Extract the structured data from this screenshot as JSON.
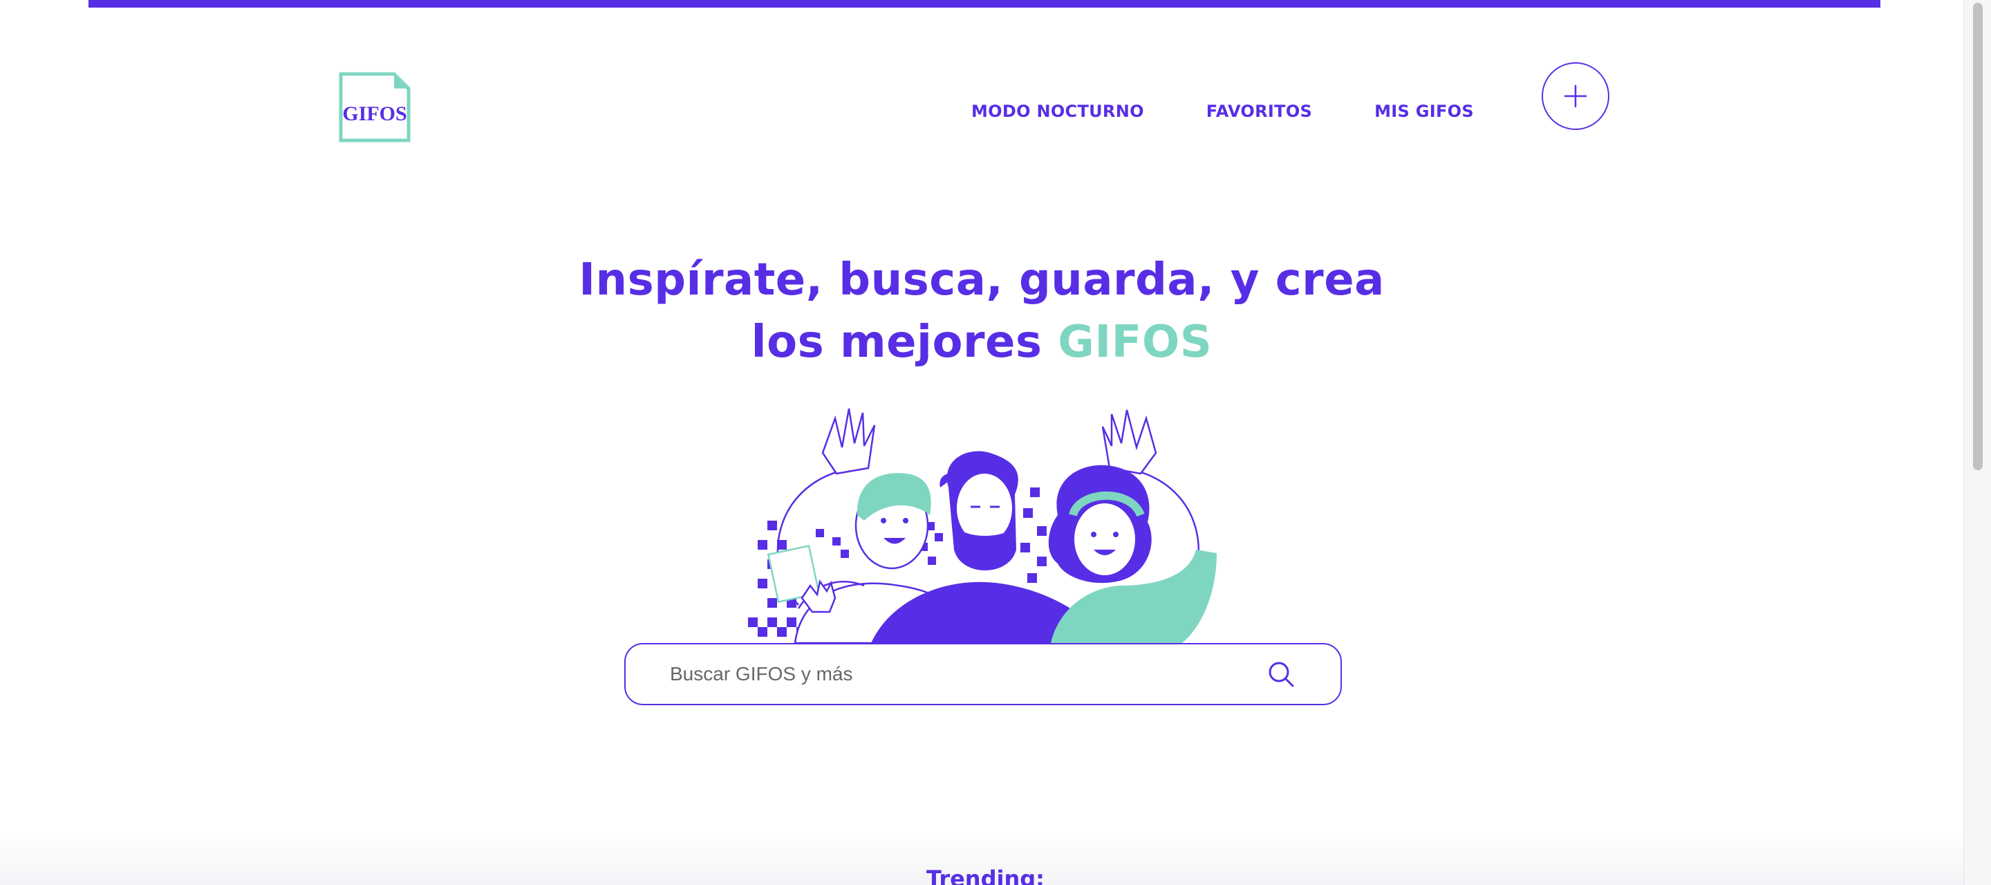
{
  "header": {
    "logo_text": "GIFOS",
    "nav": {
      "night_mode": "MODO NOCTURNO",
      "favorites": "FAVORITOS",
      "my_gifos": "MIS GIFOS"
    },
    "create_icon": "plus-icon"
  },
  "hero": {
    "title_line1": "Inspírate, busca, guarda, y crea",
    "title_line2_prefix": "los mejores",
    "title_line2_accent": "GIFOS"
  },
  "search": {
    "value": "",
    "placeholder": "Buscar GIFOS y más",
    "icon": "search-icon"
  },
  "trending": {
    "label": "Trending:"
  },
  "colors": {
    "primary": "#572ee5",
    "accent": "#7ed6c1",
    "background": "#ffffff"
  }
}
